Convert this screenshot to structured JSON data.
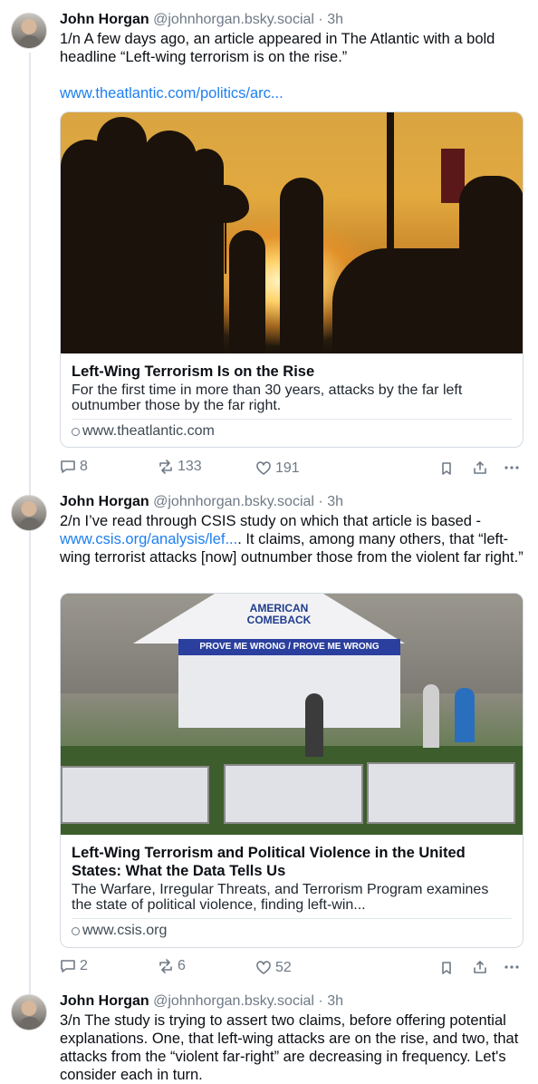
{
  "posts": [
    {
      "author": "John Horgan",
      "handle": "@johnhorgan.bsky.social",
      "time": "3h",
      "text": "1/n A few days ago, an article appeared in The Atlantic with a bold headline “Left-wing terrorism is on the rise.”",
      "link": "www.theatlantic.com/politics/arc...",
      "card": {
        "title": "Left-Wing Terrorism Is on the Rise",
        "description": "For the first time in more than 30 years, attacks by the far left outnumber those by the far right.",
        "domain": "www.theatlantic.com"
      },
      "stats": {
        "replies": "8",
        "reposts": "133",
        "likes": "191"
      }
    },
    {
      "author": "John Horgan",
      "handle": "@johnhorgan.bsky.social",
      "time": "3h",
      "text_before": "2/n I’ve read through CSIS study on which that article is based - ",
      "text_link": "www.csis.org/analysis/lef...",
      "text_after": ". It claims, among many others, that “left-wing terrorist attacks [now] outnumber those from the violent far right.”",
      "card": {
        "title": "Left-Wing Terrorism and Political Violence in the United States: What the Data Tells Us",
        "description": "The Warfare, Irregular Threats, and Terrorism Program examines the state of political violence, finding left-win...",
        "domain": "www.csis.org",
        "image_text": {
          "brand": "AMERICAN COMEBACK",
          "banner": "PROVE ME WRONG / PROVE ME WRONG"
        }
      },
      "stats": {
        "replies": "2",
        "reposts": "6",
        "likes": "52"
      }
    },
    {
      "author": "John Horgan",
      "handle": "@johnhorgan.bsky.social",
      "time": "3h",
      "text": "3/n The study is trying to assert two claims, before offering potential explanations. One, that left-wing attacks are on the rise, and two, that attacks from the “violent far-right” are decreasing in frequency. Let's consider each in turn."
    }
  ],
  "colors": {
    "link": "#1d7ff0",
    "muted": "#6f7a86",
    "border": "#d4dbe2"
  },
  "icons": [
    "reply-icon",
    "repost-icon",
    "heart-icon",
    "bookmark-icon",
    "share-icon",
    "more-icon",
    "globe-icon"
  ]
}
